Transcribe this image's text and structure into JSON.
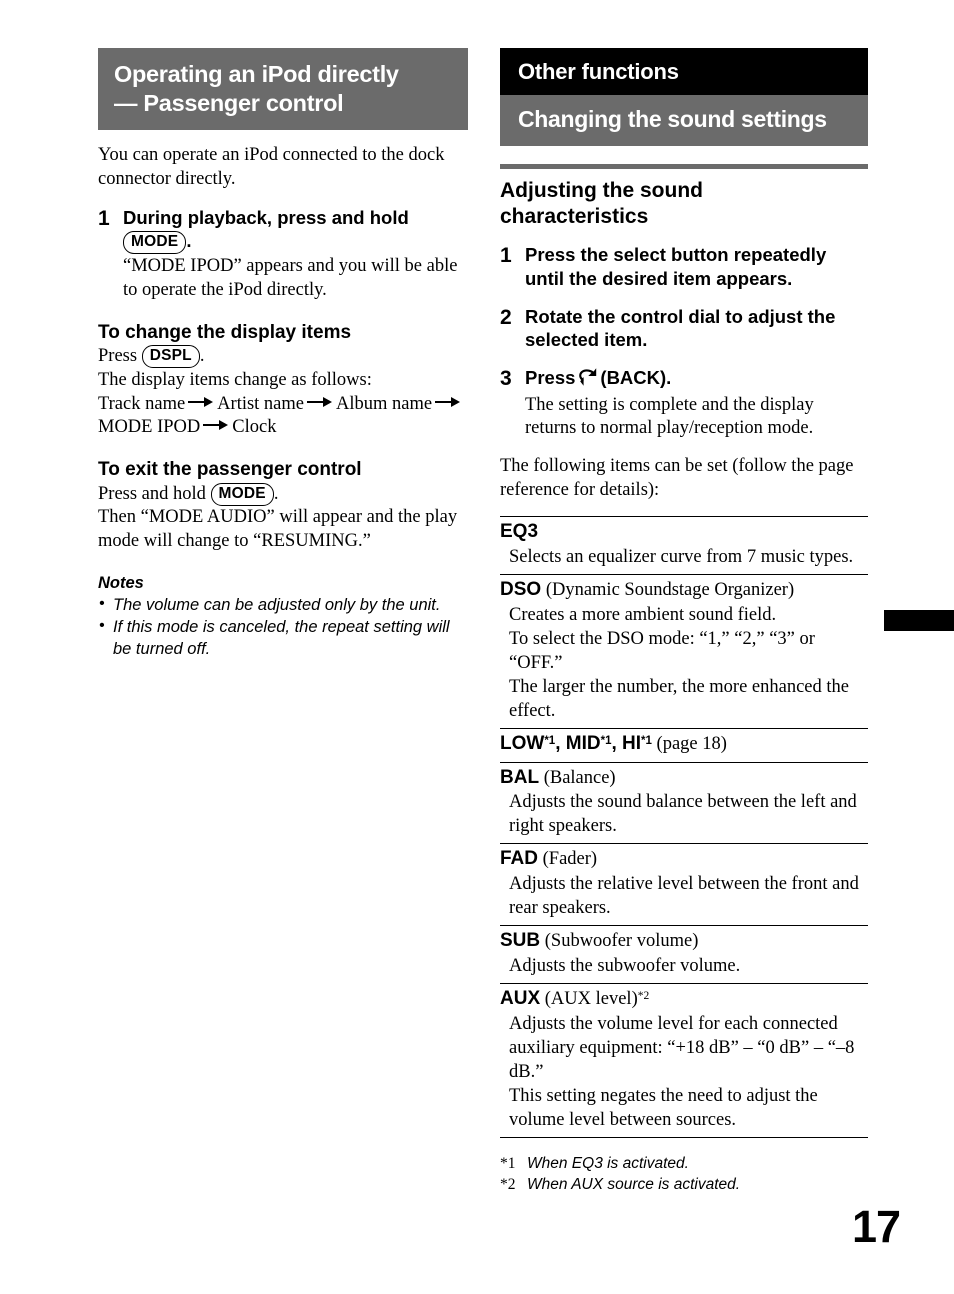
{
  "page": {
    "number": "17"
  },
  "left_column": {
    "banner": {
      "line1": "Operating an iPod directly",
      "line2": "— Passenger control"
    },
    "intro": "You can operate an iPod connected to the dock connector directly.",
    "step1": {
      "num": "1",
      "title_before_key": "During playback, press and hold",
      "key": "MODE",
      "after_key": ".",
      "desc_line1": "“MODE IPOD” appears and you will be able",
      "desc_line2": "to operate the iPod directly."
    },
    "display_items": {
      "heading": "To change the display items",
      "press_label": "Press",
      "key": "DSPL",
      "press_after": ".",
      "note": "The display items change as follows:",
      "sequence": [
        "Track name",
        "Artist name",
        "Album name",
        "MODE IPOD",
        "Clock"
      ]
    },
    "exit_passenger": {
      "heading": "To exit the passenger control",
      "press_label": "Press and hold",
      "key": "MODE",
      "press_after": ".",
      "line1": "Then “MODE AUDIO” will appear and the play",
      "line2": "mode will change to “RESUMING.”"
    },
    "notes": {
      "heading": "Notes",
      "items": [
        "The volume can be adjusted only by the unit.",
        "If this mode is canceled, the repeat setting will be turned off."
      ]
    }
  },
  "right_column": {
    "banner_chapter": "Other functions",
    "banner_section": "Changing the sound settings",
    "section_heading": {
      "line1": "Adjusting the sound",
      "line2": "characteristics"
    },
    "steps": [
      {
        "num": "1",
        "title_line1": "Press the select button repeatedly",
        "title_line2": "until the desired item appears."
      },
      {
        "num": "2",
        "title_line1": "Rotate the control dial to adjust the",
        "title_line2": "selected item."
      },
      {
        "num": "3",
        "title_before_icon": "Press",
        "icon": "back-arrow-icon",
        "title_after_icon": "(BACK).",
        "desc_line1": "The setting is complete and the display",
        "desc_line2": "returns to normal play/reception mode."
      }
    ],
    "following_items_note_line1": "The following items can be set (follow the page",
    "following_items_note_line2": "reference for details):",
    "settings": [
      {
        "term": "EQ3",
        "term_suffix": "",
        "desc_lines": [
          "Selects an equalizer curve from 7 music types."
        ]
      },
      {
        "term": "DSO",
        "term_suffix": " (Dynamic Soundstage Organizer)",
        "desc_lines": [
          "Creates a more ambient sound field.",
          "To select the DSO mode: “1,” “2,” “3” or “OFF.”",
          "The larger the number, the more enhanced the",
          "effect."
        ]
      },
      {
        "term": "LOW*1, MID*1, HI*1",
        "term_suffix": " (page 18)",
        "desc_lines": []
      },
      {
        "term": "BAL",
        "term_suffix": " (Balance)",
        "desc_lines": [
          "Adjusts the sound balance between the left and",
          "right speakers."
        ]
      },
      {
        "term": "FAD",
        "term_suffix": " (Fader)",
        "desc_lines": [
          "Adjusts the relative level between the front and",
          "rear speakers."
        ]
      },
      {
        "term": "SUB",
        "term_suffix": " (Subwoofer volume)",
        "desc_lines": [
          "Adjusts the subwoofer volume."
        ]
      },
      {
        "term": "AUX",
        "term_suffix": " (AUX level)*2",
        "desc_lines": [
          "Adjusts the volume level for each connected",
          "auxiliary equipment: “+18 dB” – “0 dB” – “–8",
          "dB.”",
          "This setting negates the need to adjust the",
          "volume level between sources."
        ]
      }
    ],
    "footnotes": [
      {
        "marker": "*1",
        "text": "When EQ3 is activated."
      },
      {
        "marker": "*2",
        "text": "When AUX source is activated."
      }
    ]
  },
  "colors": {
    "banner_gray": "#6b6b6b",
    "banner_black": "#000000",
    "text": "#000000",
    "page_background": "#ffffff"
  }
}
